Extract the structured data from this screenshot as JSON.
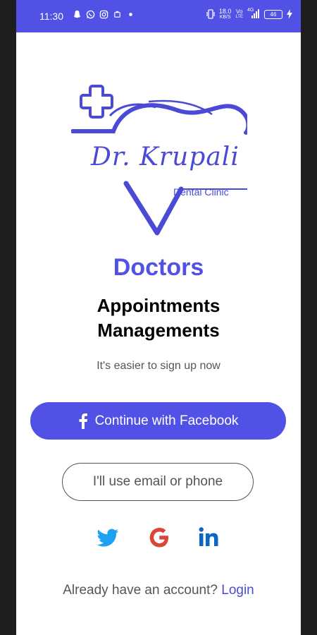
{
  "status_bar": {
    "time": "11:30",
    "net_speed_value": "18.0",
    "net_speed_unit": "KB/S",
    "volte_top": "Vo",
    "volte_bottom": "LTE",
    "network": "4G",
    "battery": "46",
    "left_icons": [
      "snapchat-icon",
      "whatsapp-icon",
      "instagram-icon",
      "notification-icon",
      "dot-icon"
    ],
    "right_icons": [
      "vibrate-icon",
      "signal-icon",
      "charging-icon"
    ]
  },
  "logo": {
    "name": "Dr. Krupali",
    "subtitle": "Dental Clinic",
    "color": "#4a4ad6"
  },
  "heading": {
    "title": "Doctors",
    "line1": "Appointments",
    "line2": "Managements"
  },
  "tagline": "It's easier to sign up now",
  "buttons": {
    "facebook_label": "Continue with Facebook",
    "email_label": "I'll use email or phone"
  },
  "social": [
    "twitter-icon",
    "google-icon",
    "linkedin-icon"
  ],
  "footer": {
    "prompt": "Already have an account?",
    "login_label": "Login"
  },
  "colors": {
    "brand": "#5151e5",
    "twitter": "#1da1f2",
    "google": "#db4437",
    "linkedin": "#0a66c2"
  }
}
